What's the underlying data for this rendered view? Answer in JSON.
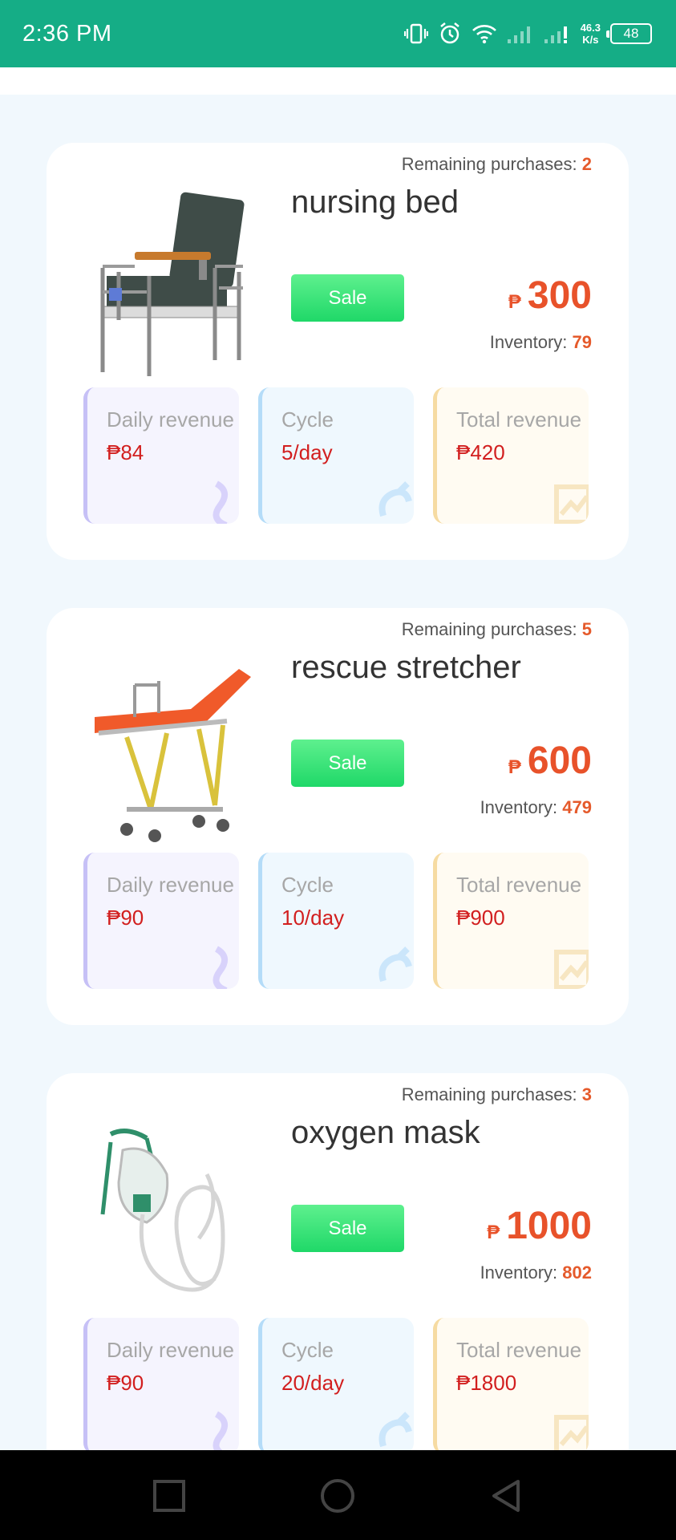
{
  "status_bar": {
    "time": "2:36 PM",
    "net_speed_value": "46.3",
    "net_speed_unit": "K/s",
    "battery": "48"
  },
  "currency_symbol": "₱",
  "labels": {
    "remaining": "Remaining purchases: ",
    "inventory": "Inventory: ",
    "sale": "Sale",
    "daily_revenue": "Daily revenue",
    "cycle": "Cycle",
    "total_revenue": "Total revenue"
  },
  "products": [
    {
      "name": "nursing bed",
      "remaining": "2",
      "price": "300",
      "inventory": "79",
      "daily_revenue": "₱84",
      "cycle": "5/day",
      "total_revenue": "₱420"
    },
    {
      "name": "rescue stretcher",
      "remaining": "5",
      "price": "600",
      "inventory": "479",
      "daily_revenue": "₱90",
      "cycle": "10/day",
      "total_revenue": "₱900"
    },
    {
      "name": "oxygen mask",
      "remaining": "3",
      "price": "1000",
      "inventory": "802",
      "daily_revenue": "₱90",
      "cycle": "20/day",
      "total_revenue": "₱1800"
    }
  ],
  "colors": {
    "status_bar": "#15ad86",
    "sale_button": "#1fd868",
    "price": "#e8522a",
    "revenue_value": "#d21f1f"
  }
}
